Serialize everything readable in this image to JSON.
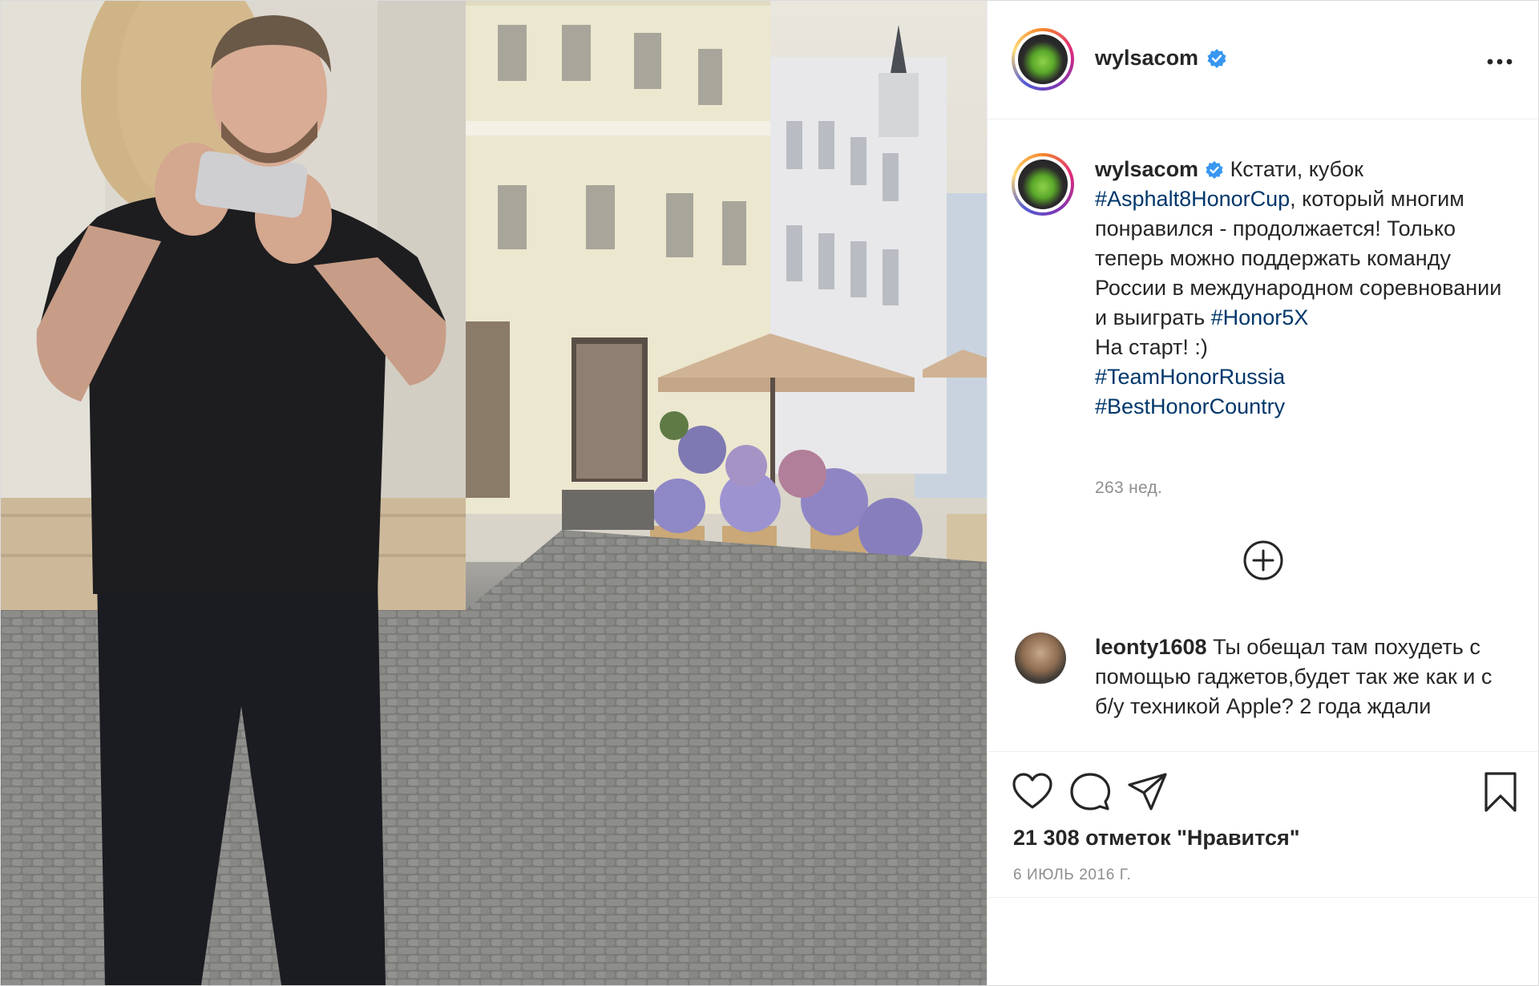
{
  "colors": {
    "text": "#262626",
    "hashtag": "#00376b",
    "muted": "#8e8e8e",
    "verified": "#3897f0",
    "border": "#efefef"
  },
  "header": {
    "username": "wylsacom",
    "verified_icon": "verified-badge-icon",
    "more_icon": "more-options-icon"
  },
  "caption": {
    "username": "wylsacom",
    "text_1": " Кстати, кубок ",
    "tag_1": "#Asphalt8HonorCup",
    "text_2": ", который многим понравился - продолжается! Только теперь можно поддержать команду России в международном соревновании и выиграть ",
    "tag_2": "#Honor5X",
    "text_3": "На старт! :)",
    "tag_3": "#TeamHonorRussia",
    "tag_4": "#BestHonorCountry",
    "age": "263 нед."
  },
  "load_more_icon": "plus-circle-icon",
  "comment": {
    "username": "leonty1608",
    "text": " Ты обещал там похудеть с помощью гаджетов,будет так же как и с б/у техникой Apple? 2 года ждали"
  },
  "actions": {
    "like_icon": "heart-icon",
    "comment_icon": "comment-icon",
    "share_icon": "paper-plane-icon",
    "save_icon": "bookmark-icon",
    "likes_text": "21 308 отметок \"Нравится\"",
    "date": "6 июль 2016 г."
  }
}
